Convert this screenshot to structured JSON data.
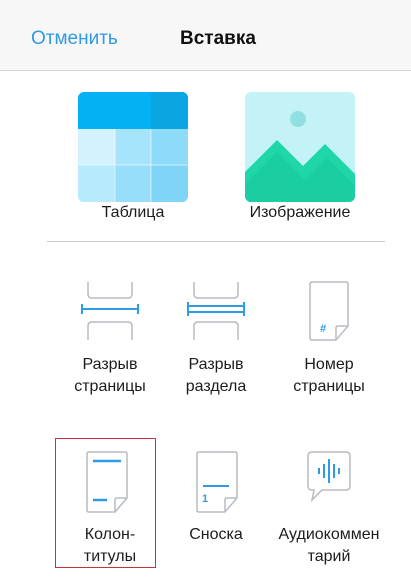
{
  "header": {
    "cancel_label": "Отменить",
    "title": "Вставка"
  },
  "main_items": [
    {
      "label": "Таблица",
      "icon": "table-icon"
    },
    {
      "label": "Изображение",
      "icon": "image-icon"
    }
  ],
  "grid_items": [
    {
      "label_line1": "Разрыв",
      "label_line2": "страницы",
      "icon": "page-break-icon"
    },
    {
      "label_line1": "Разрыв",
      "label_line2": "раздела",
      "icon": "section-break-icon"
    },
    {
      "label_line1": "Номер",
      "label_line2": "страницы",
      "icon": "page-number-icon"
    },
    {
      "label_line1": "Колон-",
      "label_line2": "титулы",
      "icon": "header-footer-icon",
      "selected": true
    },
    {
      "label_line1": "Сноска",
      "label_line2": "",
      "icon": "footnote-icon"
    },
    {
      "label_line1": "Аудиокоммен",
      "label_line2": "тарий",
      "icon": "audio-comment-icon"
    }
  ],
  "colors": {
    "accent": "#2f9be6",
    "selection": "#c8313a",
    "image_bg": "#c3f3f6",
    "image_mountain": "#1fd6a8"
  }
}
